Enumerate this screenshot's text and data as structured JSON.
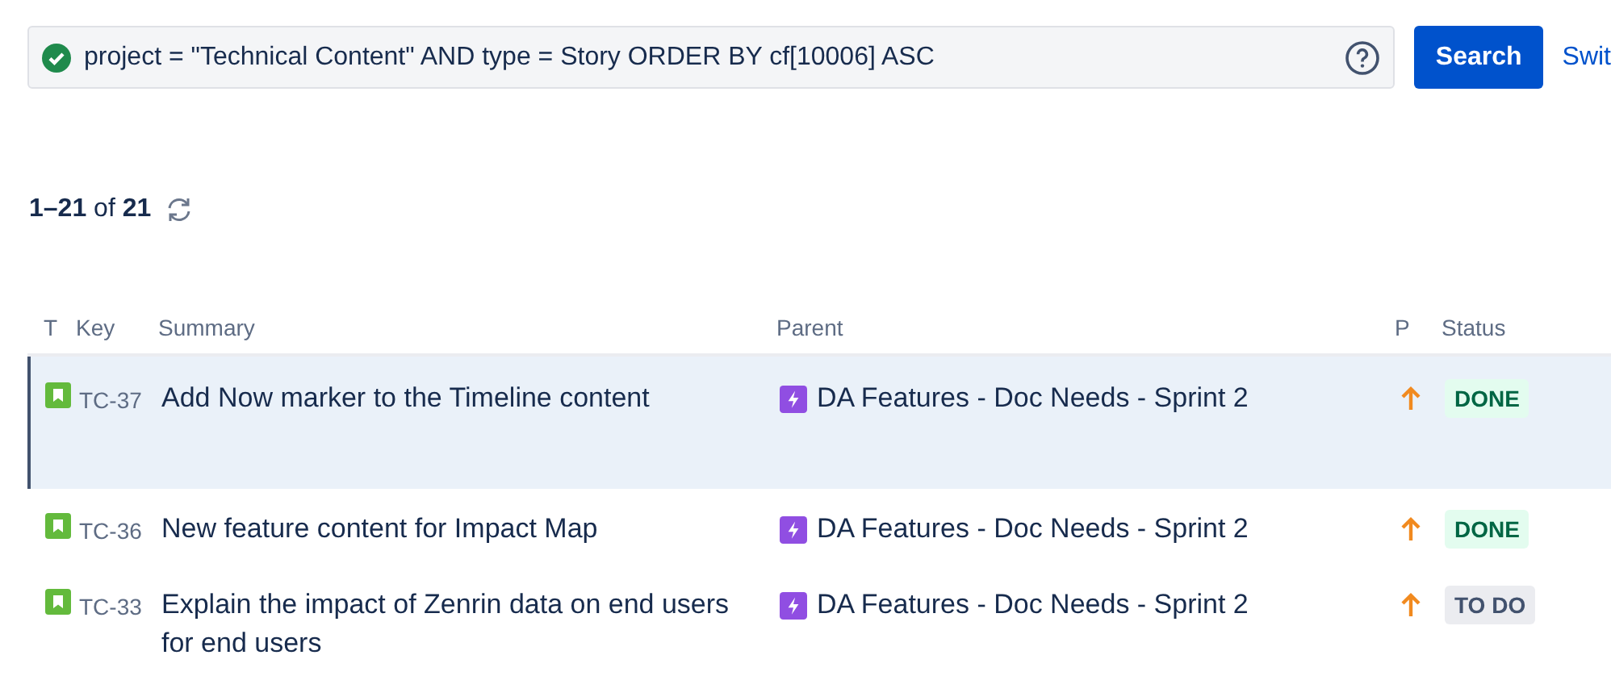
{
  "search": {
    "value": "project = \"Technical Content\" AND type = Story ORDER BY cf[10006] ASC",
    "valid": true,
    "button": "Search",
    "switch_link": "Swit"
  },
  "result_count": "**1–21** of **21**",
  "table": {
    "columns": [
      "T",
      "Key",
      "Summary",
      "Parent",
      "P",
      "Status"
    ],
    "rows": [
      {
        "key": "TC-37",
        "summary": "Add Now marker to the Timeline content",
        "parent": "DA Features - Doc Needs - Sprint 2",
        "status": "DONE",
        "kind": "done",
        "selected": true
      },
      {
        "key": "TC-36",
        "summary": "New feature content for Impact Map",
        "parent": "DA Features - Doc Needs - Sprint 2",
        "status": "DONE",
        "kind": "done",
        "selected": false
      },
      {
        "key": "TC-33",
        "summary": "Explain the impact of Zenrin data on end users for end users",
        "parent": "DA Features - Doc Needs - Sprint 2",
        "status": "TO DO",
        "kind": "todo",
        "selected": false
      }
    ]
  }
}
